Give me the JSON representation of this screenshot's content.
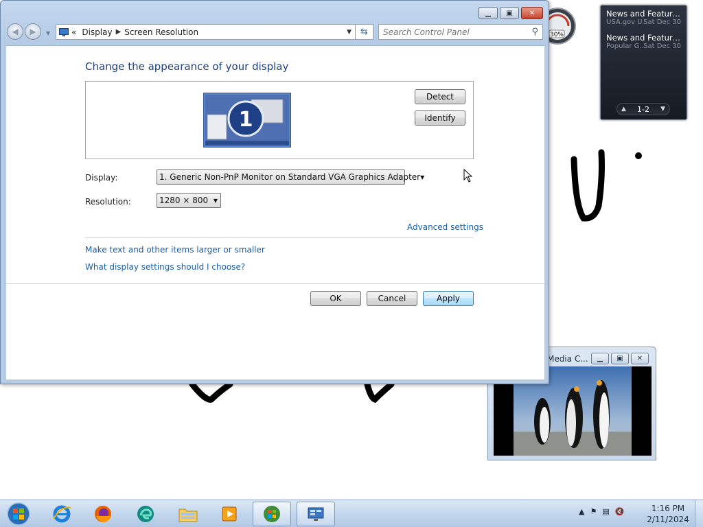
{
  "window": {
    "breadcrumb": [
      "Display",
      "Screen Resolution"
    ],
    "breadcrumb_prefix": "«",
    "search_placeholder": "Search Control Panel",
    "heading": "Change the appearance of your display",
    "monitor_number": "1",
    "detect_label": "Detect",
    "identify_label": "Identify",
    "display_label": "Display:",
    "display_value": "1. Generic Non-PnP Monitor on Standard VGA Graphics Adapter",
    "resolution_label": "Resolution:",
    "resolution_value": "1280 × 800",
    "advanced_link": "Advanced settings",
    "links": [
      "Make text and other items larger or smaller",
      "What display settings should I choose?"
    ],
    "ok_label": "OK",
    "cancel_label": "Cancel",
    "apply_label": "Apply"
  },
  "gadgets": {
    "cpu_percent": "30%",
    "news": [
      {
        "title": "News and Feature...",
        "source": "USA.gov U...",
        "date": "Sat Dec 30"
      },
      {
        "title": "News and Feature...",
        "source": "Popular G...",
        "date": "Sat Dec 30"
      }
    ],
    "news_page": "1-2"
  },
  "media_window": {
    "title": "Media C..."
  },
  "taskbar": {
    "items": [
      "internet-explorer",
      "firefox",
      "edge",
      "file-explorer",
      "media-player",
      "windows-update",
      "display-control-panel"
    ],
    "time": "1:16 PM",
    "date": "2/11/2024"
  },
  "colors": {
    "accent": "#1e3f7a",
    "link": "#1a5ea8"
  }
}
